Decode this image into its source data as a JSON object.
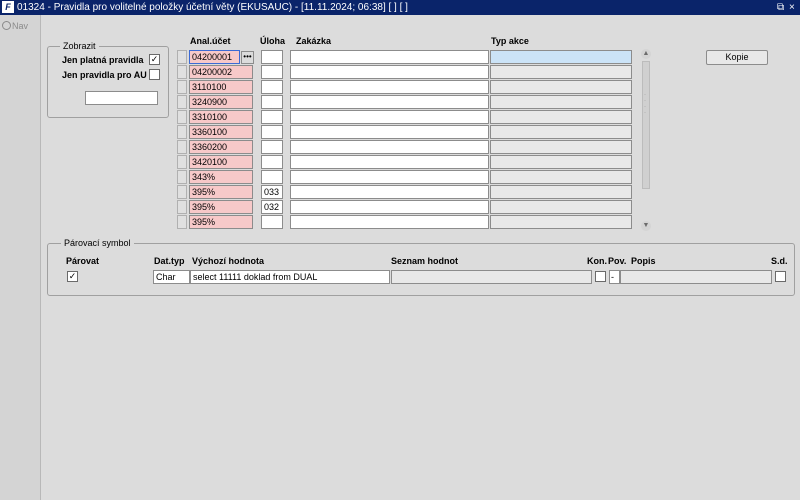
{
  "window": {
    "title": "01324 - Pravidla pro volitelné položky účetní věty (EKUSAUC) - [11.11.2024; 06:38]  [ ]  [ ]",
    "icon_text": "F",
    "restore_icon": "restore-icon",
    "close_icon": "close-icon",
    "restore_glyph": "⧉",
    "close_glyph": "×"
  },
  "nav": {
    "label": "Nav"
  },
  "zobrazit": {
    "legend": "Zobrazit",
    "jen_platna_label": "Jen platná pravidla",
    "jen_platna_checked": "✓",
    "jen_au_label": "Jen pravidla pro AU",
    "jen_au_checked": "",
    "text_value": ""
  },
  "table": {
    "headers": {
      "anal_ucet": "Anal.účet",
      "uloha": "Úloha",
      "zakazka": "Zakázka",
      "typ_akce": "Typ akce"
    },
    "ellipsis": "•••",
    "rows": [
      {
        "anal_ucet": "04200001",
        "uloha": "",
        "zakazka": "",
        "typ_akce": ""
      },
      {
        "anal_ucet": "04200002",
        "uloha": "",
        "zakazka": "",
        "typ_akce": ""
      },
      {
        "anal_ucet": "3110100",
        "uloha": "",
        "zakazka": "",
        "typ_akce": ""
      },
      {
        "anal_ucet": "3240900",
        "uloha": "",
        "zakazka": "",
        "typ_akce": ""
      },
      {
        "anal_ucet": "3310100",
        "uloha": "",
        "zakazka": "",
        "typ_akce": ""
      },
      {
        "anal_ucet": "3360100",
        "uloha": "",
        "zakazka": "",
        "typ_akce": ""
      },
      {
        "anal_ucet": "3360200",
        "uloha": "",
        "zakazka": "",
        "typ_akce": ""
      },
      {
        "anal_ucet": "3420100",
        "uloha": "",
        "zakazka": "",
        "typ_akce": ""
      },
      {
        "anal_ucet": "343%",
        "uloha": "",
        "zakazka": "",
        "typ_akce": ""
      },
      {
        "anal_ucet": "395%",
        "uloha": "033",
        "zakazka": "",
        "typ_akce": ""
      },
      {
        "anal_ucet": "395%",
        "uloha": "032",
        "zakazka": "",
        "typ_akce": ""
      },
      {
        "anal_ucet": "395%",
        "uloha": "",
        "zakazka": "",
        "typ_akce": ""
      }
    ]
  },
  "scroll": {
    "up": "▲",
    "down": "▼",
    "grip": "· · · ·"
  },
  "buttons": {
    "kopie": "Kopie"
  },
  "parovaci": {
    "legend": "Párovací symbol",
    "headers": {
      "parovat": "Párovat",
      "dat_typ": "Dat.typ",
      "vychozi": "Výchozí hodnota",
      "seznam": "Seznam hodnot",
      "kon": "Kon.",
      "pov": "Pov.",
      "popis": "Popis",
      "sd": "S.d."
    },
    "row": {
      "parovat_checked": "✓",
      "dat_typ": "Char",
      "vychozi": "select 11111 doklad from DUAL",
      "seznam": "",
      "kon_checked": "",
      "pov": "-",
      "popis": "",
      "sd_checked": ""
    }
  }
}
